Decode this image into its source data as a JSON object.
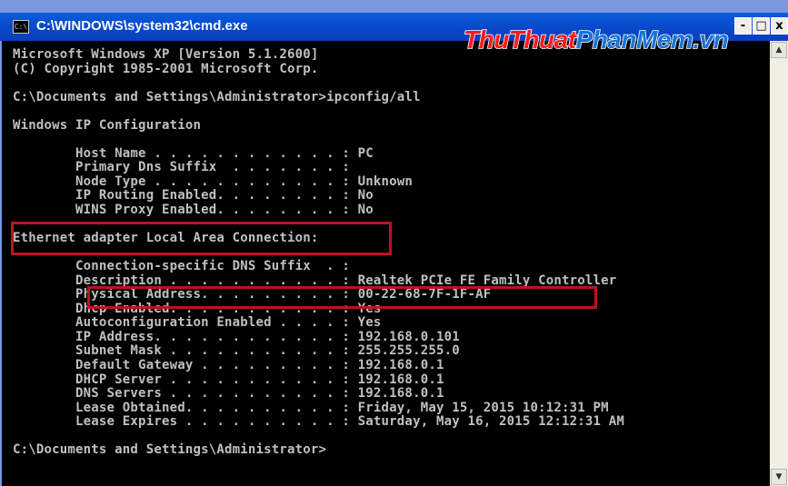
{
  "window": {
    "title": "C:\\WINDOWS\\system32\\cmd.exe",
    "icon_label": "C:\\",
    "controls": {
      "minimize": "-",
      "maximize": "□",
      "close": "x"
    }
  },
  "watermark": {
    "part1": "ThuThuat",
    "part2": "PhanMem",
    "part3": ".vn",
    "color1": "#ff1a1a",
    "color2": "#1b74d6"
  },
  "console": {
    "lines": [
      "Microsoft Windows XP [Version 5.1.2600]",
      "(C) Copyright 1985-2001 Microsoft Corp.",
      "",
      "C:\\Documents and Settings\\Administrator>ipconfig/all",
      "",
      "Windows IP Configuration",
      "",
      "        Host Name . . . . . . . . . . . . : PC",
      "        Primary Dns Suffix  . . . . . . . :",
      "        Node Type . . . . . . . . . . . . : Unknown",
      "        IP Routing Enabled. . . . . . . . : No",
      "        WINS Proxy Enabled. . . . . . . . : No",
      "",
      "Ethernet adapter Local Area Connection:",
      "",
      "        Connection-specific DNS Suffix  . :",
      "        Description . . . . . . . . . . . : Realtek PCIe FE Family Controller",
      "        Physical Address. . . . . . . . . : 00-22-68-7F-1F-AF",
      "        Dhcp Enabled. . . . . . . . . . . : Yes",
      "        Autoconfiguration Enabled . . . . : Yes",
      "        IP Address. . . . . . . . . . . . : 192.168.0.101",
      "        Subnet Mask . . . . . . . . . . . : 255.255.255.0",
      "        Default Gateway . . . . . . . . . : 192.168.0.1",
      "        DHCP Server . . . . . . . . . . . : 192.168.0.1",
      "        DNS Servers . . . . . . . . . . . : 192.168.0.1",
      "        Lease Obtained. . . . . . . . . . : Friday, May 15, 2015 10:12:31 PM",
      "        Lease Expires . . . . . . . . . . : Saturday, May 16, 2015 12:12:31 AM",
      "",
      "C:\\Documents and Settings\\Administrator>"
    ]
  },
  "scrollbar": {
    "up_icon": "▲",
    "down_icon": "▼"
  }
}
